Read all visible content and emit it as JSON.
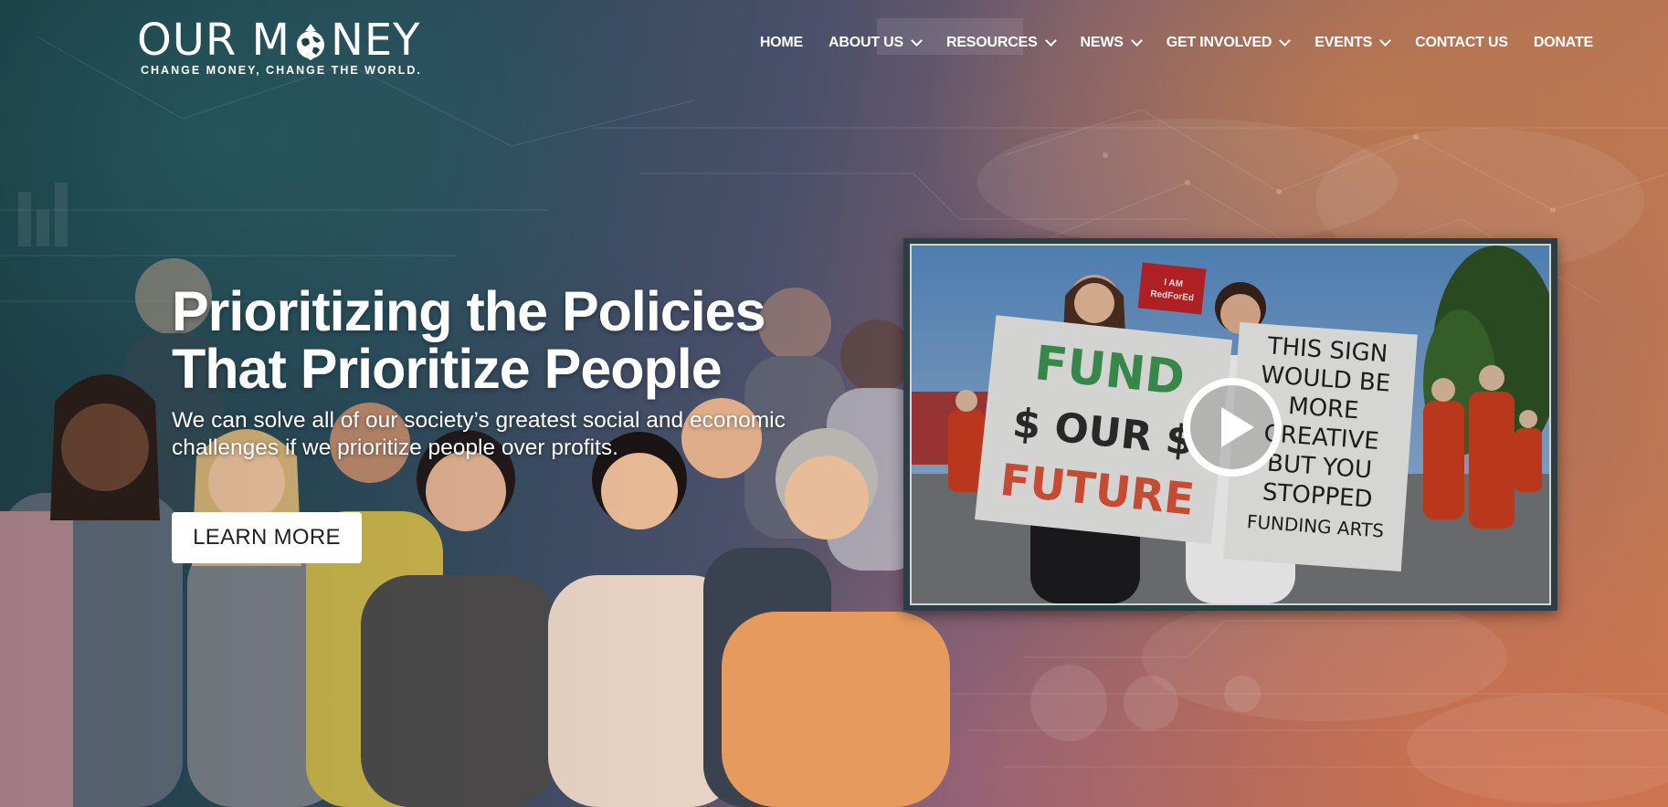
{
  "logo": {
    "title_left": "OUR M",
    "title_right": "NEY",
    "tagline": "CHANGE MONEY, CHANGE THE WORLD."
  },
  "nav": {
    "items": [
      {
        "label": "HOME",
        "dropdown": false
      },
      {
        "label": "ABOUT US",
        "dropdown": true
      },
      {
        "label": "RESOURCES",
        "dropdown": true
      },
      {
        "label": "NEWS",
        "dropdown": true
      },
      {
        "label": "GET INVOLVED",
        "dropdown": true
      },
      {
        "label": "EVENTS",
        "dropdown": true
      },
      {
        "label": "CONTACT US",
        "dropdown": false
      },
      {
        "label": "DONATE",
        "dropdown": false
      }
    ]
  },
  "hero": {
    "title_line1": "Prioritizing the Policies",
    "title_line2": "That Prioritize People",
    "subtitle_line1": "We can solve all of our society’s greatest social and economic",
    "subtitle_line2": "challenges if we prioritize people over profits.",
    "button_label": "LEARN MORE"
  },
  "video": {
    "sign_fund_line1": "FUND",
    "sign_fund_line2": "$ OUR $",
    "sign_fund_line3": "FUTURE",
    "sign_arts_line1": "THIS SIGN",
    "sign_arts_line2": "WOULD BE",
    "sign_arts_line3": "MORE",
    "sign_arts_line4": "CREATIVE",
    "sign_arts_line5": "BUT YOU",
    "sign_arts_line6": "STOPPED",
    "sign_arts_line7": "FUNDING ARTS",
    "sign_red_line1": "I AM",
    "sign_red_line2": "RedForEd"
  },
  "colors": {
    "accent_teal": "#1b4048",
    "accent_orange": "#c27a52",
    "button_bg": "#ffffff",
    "button_text": "#222222"
  },
  "icons": {
    "play": "play-circle-icon",
    "chevron": "chevron-down-icon",
    "logo_globe": "globe-icon"
  }
}
